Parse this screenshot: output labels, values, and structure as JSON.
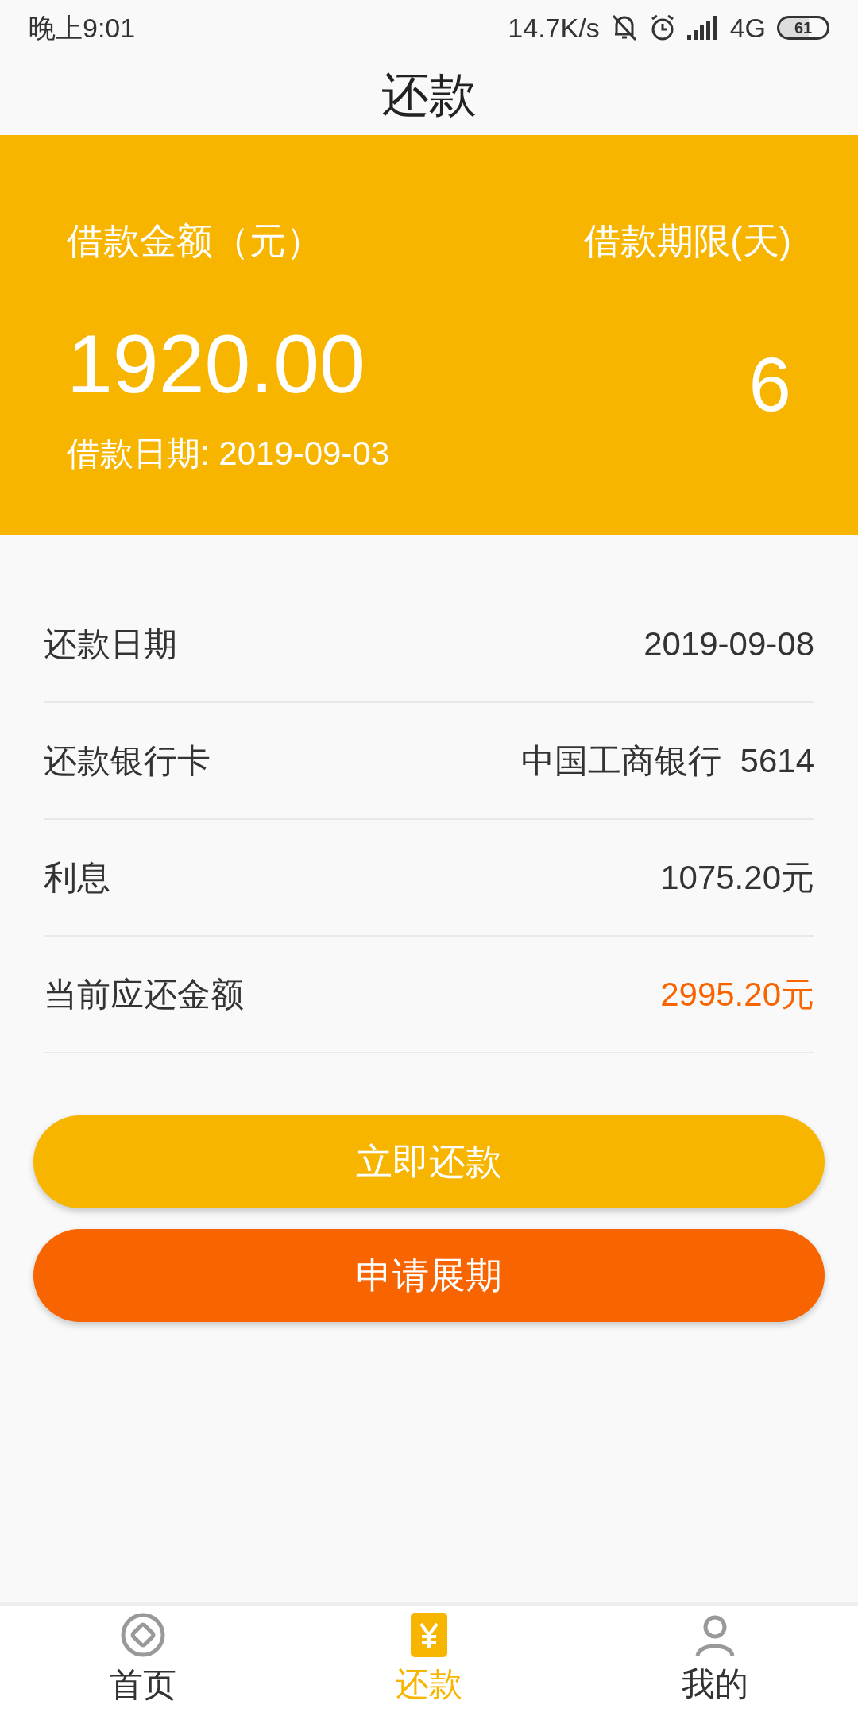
{
  "status_bar": {
    "time": "晚上9:01",
    "speed": "14.7K/s",
    "network": "4G",
    "battery": "61"
  },
  "title": "还款",
  "summary": {
    "amount_label": "借款金额（元）",
    "term_label": "借款期限(天)",
    "amount": "1920.00",
    "term": "6",
    "date": "借款日期: 2019-09-03"
  },
  "details": [
    {
      "label": "还款日期",
      "value": "2019-09-08",
      "highlight": false
    },
    {
      "label": "还款银行卡",
      "value": "中国工商银行  5614",
      "highlight": false
    },
    {
      "label": "利息",
      "value": "1075.20元",
      "highlight": false
    },
    {
      "label": "当前应还金额",
      "value": "2995.20元",
      "highlight": true
    }
  ],
  "buttons": [
    {
      "label": "立即还款",
      "kind": "primary"
    },
    {
      "label": "申请展期",
      "kind": "secondary"
    }
  ],
  "tabs": [
    {
      "label": "首页",
      "kind": "home",
      "selected": false
    },
    {
      "label": "还款",
      "kind": "repay",
      "selected": true
    },
    {
      "label": "我的",
      "kind": "me",
      "selected": false
    }
  ]
}
